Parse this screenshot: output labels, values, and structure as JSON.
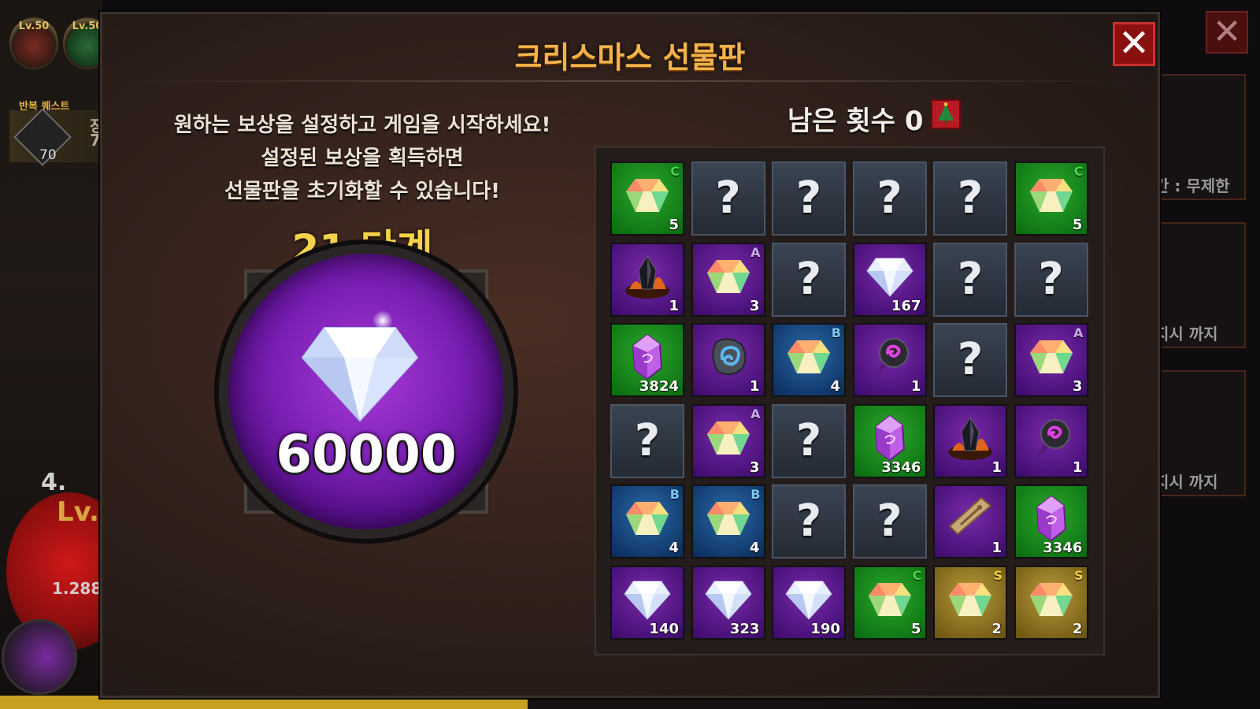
{
  "hud": {
    "level_badges": [
      {
        "label": "Lv.50"
      },
      {
        "label": "Lv.50"
      }
    ],
    "quest_title": "반복 퀘스트",
    "quest_count": "70",
    "side_chars": [
      "장",
      "7"
    ],
    "power": "4.",
    "level_text": "Lv.",
    "hp_text": "1.288",
    "right_panels": [
      "간 : 무제한",
      "지시 까지",
      "지시 까지"
    ]
  },
  "dialog": {
    "title": "크리스마스 선물판",
    "close_label": "✕",
    "instructions": [
      "원하는 보상을 설정하고 게임을 시작하세요!",
      "설정된 보상을 획득하면",
      "선물판을 초기화할 수 있습니다!"
    ],
    "stage_label": "21 단계",
    "main_reward_value": "60000",
    "main_reward_icon": "diamond-icon",
    "remaining_label": "남은 횟수",
    "remaining_count": "0"
  },
  "colors": {
    "accent_title": "#f2b24a",
    "stage_gold": "#f4d24a",
    "grade_C": "#4cd64c",
    "grade_A": "#c8a8e8",
    "grade_B": "#7ac8f0",
    "grade_S": "#f0d040"
  },
  "grid": [
    [
      {
        "bg": "green",
        "icon": "gem-icon",
        "grade": "C",
        "count": "5"
      },
      {
        "bg": "gray",
        "icon": "question-icon"
      },
      {
        "bg": "gray",
        "icon": "question-icon"
      },
      {
        "bg": "gray",
        "icon": "question-icon"
      },
      {
        "bg": "gray",
        "icon": "question-icon"
      },
      {
        "bg": "green",
        "icon": "gem-icon",
        "grade": "C",
        "count": "5"
      }
    ],
    [
      {
        "bg": "purple",
        "icon": "crystal-fire-icon",
        "count": "1"
      },
      {
        "bg": "purple",
        "icon": "gem-icon",
        "grade": "A",
        "count": "3"
      },
      {
        "bg": "gray",
        "icon": "question-icon"
      },
      {
        "bg": "purple",
        "icon": "diamond-icon",
        "count": "167"
      },
      {
        "bg": "gray",
        "icon": "question-icon"
      },
      {
        "bg": "gray",
        "icon": "question-icon"
      }
    ],
    [
      {
        "bg": "green",
        "icon": "purple-crystal-icon",
        "count": "3824"
      },
      {
        "bg": "purple",
        "icon": "rune-stone-icon",
        "count": "1"
      },
      {
        "bg": "blue",
        "icon": "gem-icon",
        "grade": "B",
        "count": "4"
      },
      {
        "bg": "purple",
        "icon": "dark-orb-icon",
        "count": "1"
      },
      {
        "bg": "gray",
        "icon": "question-icon"
      },
      {
        "bg": "purple",
        "icon": "gem-icon",
        "grade": "A",
        "count": "3"
      }
    ],
    [
      {
        "bg": "gray",
        "icon": "question-icon"
      },
      {
        "bg": "purple",
        "icon": "gem-icon",
        "grade": "A",
        "count": "3"
      },
      {
        "bg": "gray",
        "icon": "question-icon"
      },
      {
        "bg": "green",
        "icon": "purple-crystal-icon",
        "count": "3346"
      },
      {
        "bg": "purple",
        "icon": "crystal-fire-icon",
        "count": "1"
      },
      {
        "bg": "purple",
        "icon": "dark-orb-icon",
        "count": "1"
      }
    ],
    [
      {
        "bg": "blue",
        "icon": "gem-icon",
        "grade": "B",
        "count": "4"
      },
      {
        "bg": "blue",
        "icon": "gem-icon",
        "grade": "B",
        "count": "4"
      },
      {
        "bg": "gray",
        "icon": "question-icon"
      },
      {
        "bg": "gray",
        "icon": "question-icon"
      },
      {
        "bg": "purple",
        "icon": "scroll-ticket-icon",
        "count": "1"
      },
      {
        "bg": "green",
        "icon": "purple-crystal-icon",
        "count": "3346"
      }
    ],
    [
      {
        "bg": "purple",
        "icon": "diamond-icon",
        "count": "140"
      },
      {
        "bg": "purple",
        "icon": "diamond-icon",
        "count": "323"
      },
      {
        "bg": "purple",
        "icon": "diamond-icon",
        "count": "190"
      },
      {
        "bg": "green",
        "icon": "gem-icon",
        "grade": "C",
        "count": "5"
      },
      {
        "bg": "gold",
        "icon": "gem-icon",
        "grade": "S",
        "count": "2"
      },
      {
        "bg": "gold",
        "icon": "gem-icon",
        "grade": "S",
        "count": "2"
      }
    ]
  ]
}
